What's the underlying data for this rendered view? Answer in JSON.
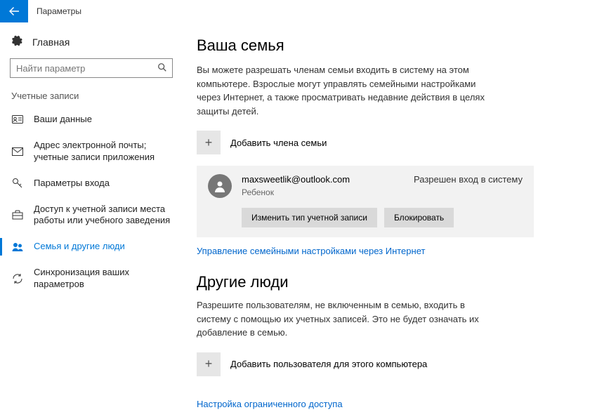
{
  "titlebar": {
    "title": "Параметры"
  },
  "sidebar": {
    "home": "Главная",
    "search_placeholder": "Найти параметр",
    "section": "Учетные записи",
    "items": [
      {
        "label": "Ваши данные"
      },
      {
        "label": "Адрес электронной почты; учетные записи приложения"
      },
      {
        "label": "Параметры входа"
      },
      {
        "label": "Доступ к учетной записи места работы или учебного заведения"
      },
      {
        "label": "Семья и другие люди"
      },
      {
        "label": "Синхронизация ваших параметров"
      }
    ]
  },
  "family": {
    "heading": "Ваша семья",
    "desc": "Вы можете разрешать членам семьи входить в систему на этом компьютере. Взрослые могут управлять семейными настройками через Интернет, а также просматривать недавние действия в целях защиты детей.",
    "add_label": "Добавить члена семьи",
    "member": {
      "email": "maxsweetlik@outlook.com",
      "status": "Разрешен вход в систему",
      "role": "Ребенок",
      "change_btn": "Изменить тип учетной записи",
      "block_btn": "Блокировать"
    },
    "manage_link": "Управление семейными настройками через Интернет"
  },
  "other": {
    "heading": "Другие люди",
    "desc": "Разрешите пользователям, не включенным в семью, входить в систему с помощью их учетных записей. Это не будет означать их добавление в семью.",
    "add_label": "Добавить пользователя для этого компьютера",
    "assigned_link": "Настройка ограниченного доступа"
  }
}
